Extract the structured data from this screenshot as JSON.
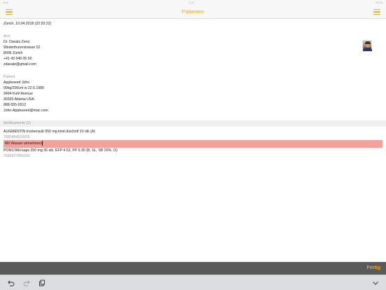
{
  "statusbar": {
    "left": "iPad",
    "center": "9:41",
    "right": "100%"
  },
  "navbar": {
    "title": "Patienten"
  },
  "date_line": "Zürich, 10.04.2018 (22:53:22)",
  "doctor": {
    "label": "Arzt",
    "name": "Dr. Davatz Zeno",
    "street": "Winterthurerstrasse 52",
    "city": "8006 Zürich",
    "phone": "+41 43 540 05 50",
    "email": "zdavatz@gmail.com"
  },
  "patient": {
    "label": "Patient",
    "name": "Appleseed John",
    "details": "90kg/200cm w 22.6.1980",
    "street": "3494 Kuhl Avenue",
    "city": "30303 Atlanta USA",
    "phone": "888-555-5512",
    "email": "John-Appleseed@mac.com"
  },
  "medications": {
    "header": "Medikamente (2)",
    "items": [
      {
        "name": "AUGMENTIN trockensub 550 mg kind durchstf 10 stk (A)",
        "code": "7680484520035"
      },
      {
        "name": "PONSTAN kaps 250 mg 36 stk, EFP 4.53, PP 9.30 (B, SL, SB 20%, O)",
        "code": "7680327850299"
      }
    ],
    "note": "Mit Wasser einnehmen"
  },
  "done_label": "Fertig",
  "colors": {
    "accent": "#f0a830",
    "highlight": "#f5a09a",
    "donebar": "#5a5a5a"
  }
}
